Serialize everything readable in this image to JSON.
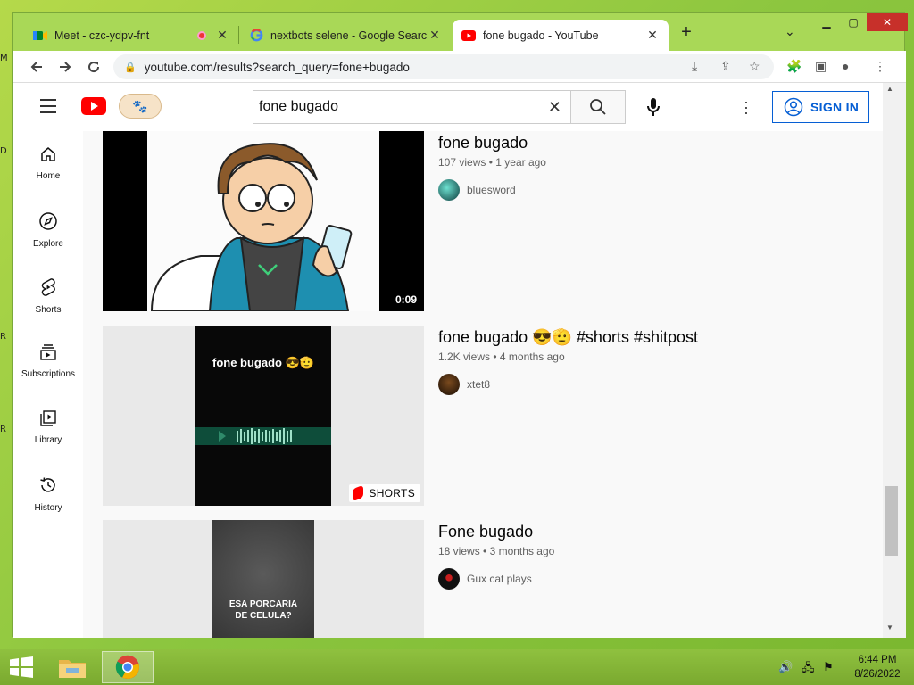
{
  "desktop": {
    "edge_letters": [
      "M",
      "D",
      "R",
      "R"
    ]
  },
  "tabs": [
    {
      "title": "Meet - czc-ydpv-fnt",
      "active": false
    },
    {
      "title": "nextbots selene - Google Search",
      "active": false
    },
    {
      "title": "fone bugado - YouTube",
      "active": true
    }
  ],
  "address": {
    "url": "youtube.com/results?search_query=fone+bugado"
  },
  "youtube": {
    "search_query": "fone bugado",
    "sign_in_label": "SIGN IN",
    "guide": [
      {
        "label": "Home",
        "icon": "home-icon"
      },
      {
        "label": "Explore",
        "icon": "compass-icon"
      },
      {
        "label": "Shorts",
        "icon": "shorts-icon"
      },
      {
        "label": "Subscriptions",
        "icon": "subscriptions-icon"
      },
      {
        "label": "Library",
        "icon": "library-icon"
      },
      {
        "label": "History",
        "icon": "history-icon"
      }
    ],
    "results": [
      {
        "title": "fone bugado",
        "views": "107 views",
        "age": "1 year ago",
        "channel": "bluesword",
        "duration": "0:09",
        "badge": ""
      },
      {
        "title": "fone bugado 😎🫡 #shorts #shitpost",
        "views": "1.2K views",
        "age": "4 months ago",
        "channel": "xtet8",
        "duration": "",
        "badge": "SHORTS",
        "thumb_text": "fone bugado 😎🫡"
      },
      {
        "title": "Fone bugado",
        "views": "18 views",
        "age": "3 months ago",
        "channel": "Gux cat plays",
        "duration": "",
        "badge": "",
        "thumb_text": "ESA PORCARIA DE CELULA?"
      }
    ]
  },
  "taskbar": {
    "time": "6:44 PM",
    "date": "8/26/2022"
  },
  "colors": {
    "yt_red": "#ff0000",
    "link_blue": "#065fd4",
    "taskbar": "#8fc13f"
  }
}
